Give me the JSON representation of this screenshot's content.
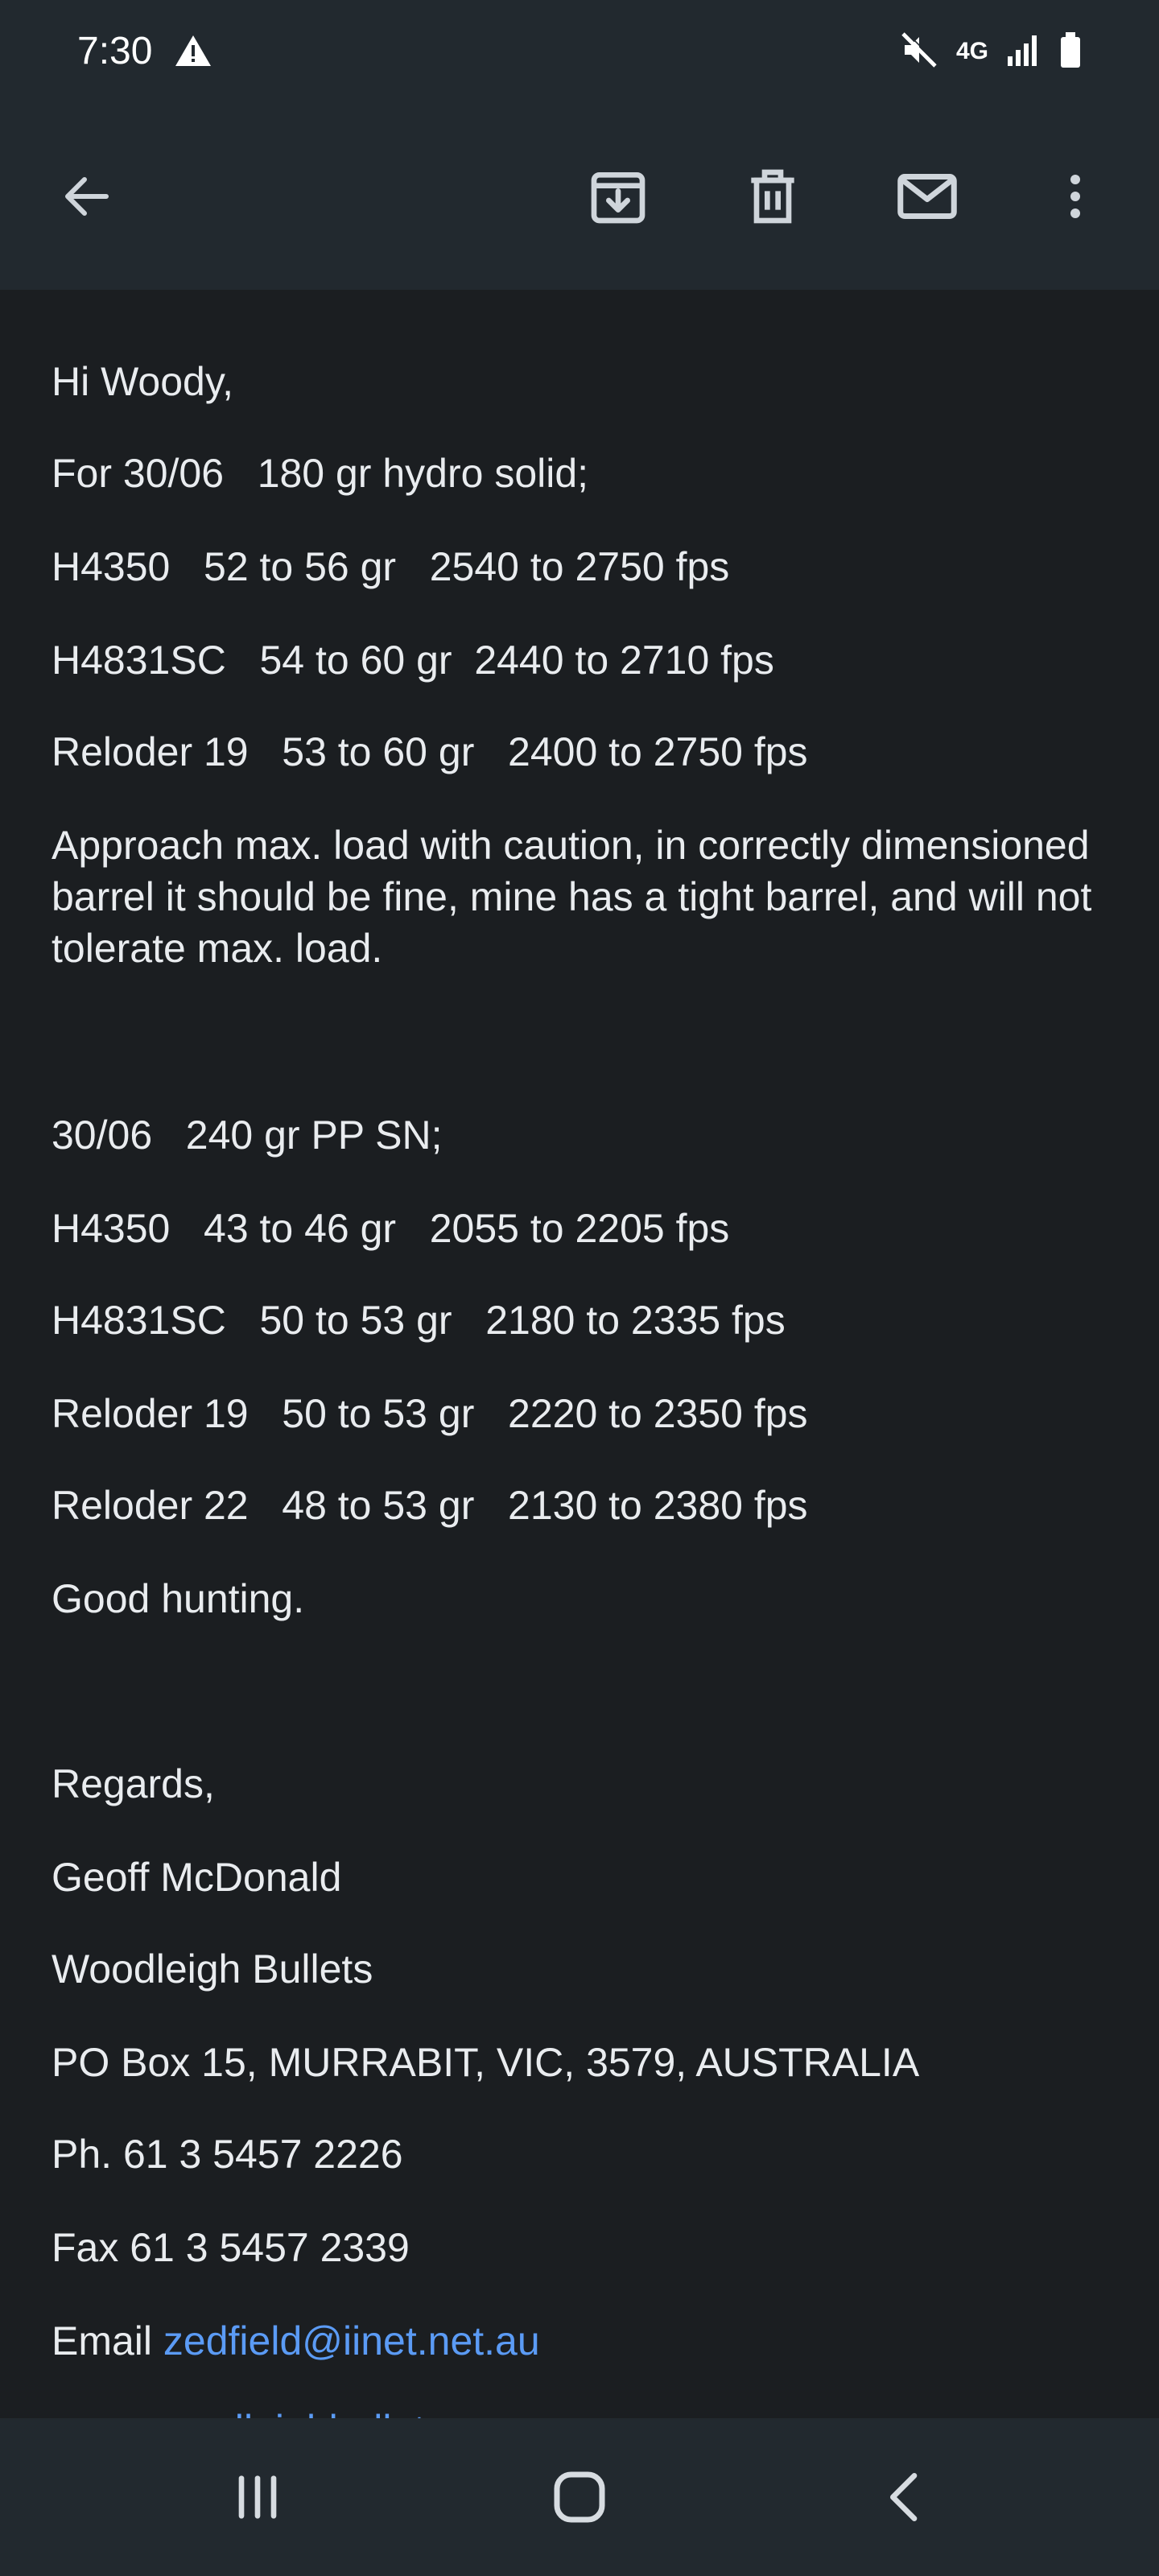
{
  "status_bar": {
    "time": "7:30",
    "network_label": "4G"
  },
  "toolbar": {
    "back_icon": "arrow-left-icon",
    "archive_icon": "archive-icon",
    "delete_icon": "trash-icon",
    "unread_icon": "mail-icon",
    "more_icon": "more-vert-icon"
  },
  "email": {
    "greeting": "Hi Woody,",
    "section1_title": "For 30/06   180 gr hydro solid;",
    "section1_loads": [
      "H4350   52 to 56 gr   2540 to 2750 fps",
      "H4831SC   54 to 60 gr  2440 to 2710 fps",
      "Reloder 19   53 to 60 gr   2400 to 2750 fps"
    ],
    "caution": "Approach max. load with caution, in correctly dimensioned barrel it should be fine, mine has a tight barrel, and will not tolerate max. load.",
    "section2_title": "30/06   240 gr PP SN;",
    "section2_loads": [
      "H4350   43 to 46 gr   2055 to 2205 fps",
      "H4831SC   50 to 53 gr   2180 to 2335 fps",
      "Reloder 19   50 to 53 gr   2220 to 2350 fps",
      "Reloder 22   48 to 53 gr   2130 to 2380 fps"
    ],
    "closing": "Good hunting.",
    "signature": {
      "regards": "Regards,",
      "name": "Geoff McDonald",
      "company": "Woodleigh Bullets",
      "address": "PO Box 15, MURRABIT, VIC, 3579, AUSTRALIA",
      "phone": "Ph. 61 3 5457 2226",
      "fax": "Fax 61 3 5457 2339",
      "email_label": "Email ",
      "email_link": "zedfield@iinet.net.au",
      "website_partial": "www.woodleighbullets"
    }
  },
  "colors": {
    "background": "#1b1e21",
    "bar": "#22292f",
    "text": "#e9ecef",
    "link": "#5b9bf5"
  }
}
